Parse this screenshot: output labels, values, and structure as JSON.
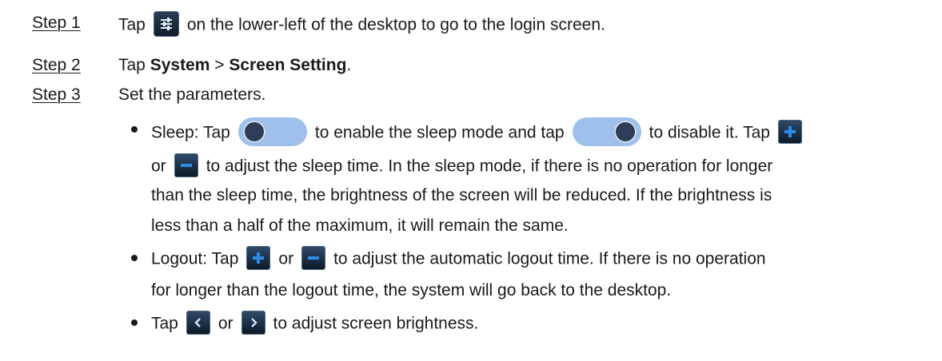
{
  "steps": [
    {
      "label": "Step 1",
      "text_before": "Tap",
      "icon": "settings-sliders-icon",
      "text_after": "on the lower-left of the desktop to go to the login screen."
    },
    {
      "label": "Step 2",
      "text_before": "Tap",
      "bold1": "System",
      "separator": ">",
      "bold2": "Screen Setting",
      "text_after": "."
    },
    {
      "label": "Step 3",
      "text": "Set the parameters."
    }
  ],
  "sleep": {
    "line1_a": "Sleep: Tap",
    "line1_b": "to enable the sleep mode and tap",
    "line1_c": "to disable it. Tap",
    "line2_a": "or",
    "line2_b": "to adjust the sleep time. In the sleep mode, if there is no operation for longer",
    "line3": "than the sleep time, the brightness of the screen will be reduced. If the brightness is",
    "line4": "less than a half of the maximum, it will remain the same."
  },
  "logout": {
    "line1_a": "Logout: Tap",
    "line1_b": "or",
    "line1_c": "to adjust the automatic logout time. If there is no operation",
    "line2": "for longer than the logout time, the system will go back to the desktop."
  },
  "brightness": {
    "line1_a": "Tap",
    "line1_b": "or",
    "line1_c": "to adjust screen brightness."
  },
  "colors": {
    "button_accent": "#2d8de6",
    "toggle_track": "#9fc0ec",
    "button_bg": "#1c2d42"
  }
}
